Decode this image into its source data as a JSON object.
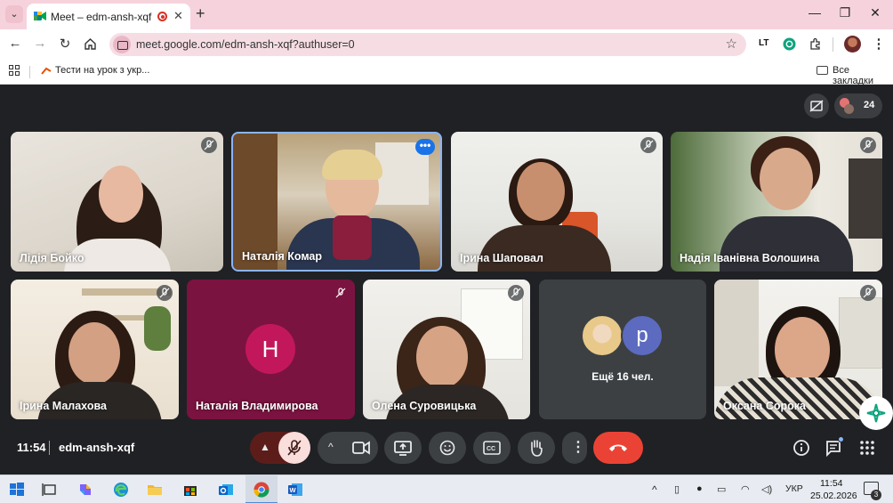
{
  "browser": {
    "tab_title": "Meet – edm-ansh-xqf",
    "url": "meet.google.com/edm-ansh-xqf?authuser=0",
    "bookmark_item": "Тести на урок з укр...",
    "bookmark_all": "Все закладки",
    "extension_lt": "LT"
  },
  "meet": {
    "participant_count": "24",
    "tiles": [
      {
        "name": "Лідія Бойко"
      },
      {
        "name": "Наталія Комар"
      },
      {
        "name": "Ірина Шаповал"
      },
      {
        "name": "Надія Іванівна Волошина"
      },
      {
        "name": "Ірина Малахова"
      },
      {
        "name": "Наталія Владимирова",
        "avatar_letter": "Н"
      },
      {
        "name": "Олена Суровицька"
      },
      {
        "name": "Оксана Сорока"
      }
    ],
    "others": {
      "label": "Ещё 16 чел.",
      "avatar_letter": "р"
    },
    "time": "11:54",
    "code": "edm-ansh-xqf",
    "colors": {
      "background": "#202124",
      "end_call": "#ea4335",
      "active_border": "#8ab4f8"
    }
  },
  "taskbar": {
    "language": "УКР",
    "time": "11:54",
    "date": "25.02.2026",
    "notifications": "3"
  }
}
